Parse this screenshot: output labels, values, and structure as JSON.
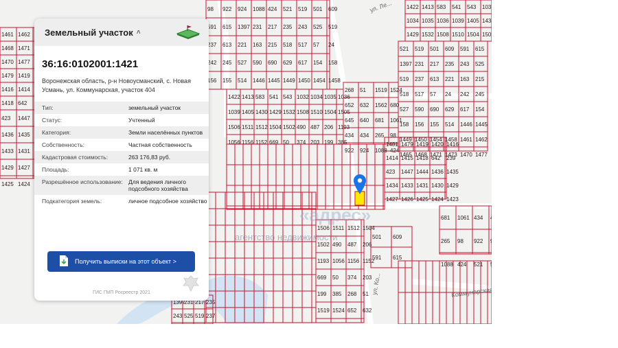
{
  "card": {
    "header_title": "Земельный участок",
    "chevron": "^",
    "cadastral_number": "36:16:0102001:1421",
    "address": "Воронежская область, р-н Новоусманский, с. Новая Усмань, ул. Коммунарская, участок 404",
    "properties": [
      {
        "label": "Тип:",
        "value": "земельный участок"
      },
      {
        "label": "Статус:",
        "value": "Учтенный"
      },
      {
        "label": "Категория:",
        "value": "Земли населённых пунктов"
      },
      {
        "label": "Собственность:",
        "value": "Частная собственность"
      },
      {
        "label": "Кадастровая стоимость:",
        "value": "263 176,83 руб."
      },
      {
        "label": "Площадь:",
        "value": "1 071 кв. м"
      },
      {
        "label": "Разрешённое использование:",
        "value": "Для ведения личного подсобного хозяйства"
      },
      {
        "label": "Подкатегория земель:",
        "value": "личное подсобное хозяйство"
      }
    ],
    "cta_label": "Получить выписки на этот объект >",
    "footer": "ГИС ГМП Росреестр 2021"
  },
  "map": {
    "streets": [
      "ул. Ле...",
      "Коммунарская",
      "ул. Ко..."
    ],
    "watermark_line1": "«адрес»",
    "watermark_line2": "агентство недвижимости",
    "parcel_color": "#c8102e",
    "highlight_color": "#ffe800",
    "marker_color": "#1a73e8",
    "parcel_numbers": [
      "98",
      "922",
      "924",
      "1088",
      "424",
      "521",
      "519",
      "501",
      "609",
      "591",
      "615",
      "1397",
      "231",
      "217",
      "235",
      "243",
      "525",
      "519",
      "237",
      "613",
      "221",
      "163",
      "215",
      "518",
      "517",
      "57",
      "24",
      "242",
      "245",
      "527",
      "590",
      "690",
      "629",
      "617",
      "154",
      "158",
      "156",
      "155",
      "514",
      "1446",
      "1445",
      "1449",
      "1450",
      "1454",
      "1458",
      "1461",
      "1462",
      "1465",
      "1468",
      "1471",
      "1473",
      "1470",
      "1477",
      "1481",
      "1479",
      "1419",
      "1420",
      "1416",
      "1414",
      "1415",
      "1418",
      "642",
      "239",
      "423",
      "1447",
      "1444",
      "1436",
      "1435",
      "1434",
      "1433",
      "1431",
      "1430",
      "1429",
      "1427",
      "1426",
      "1425",
      "1424",
      "1423",
      "1422",
      "1413",
      "583",
      "541",
      "543",
      "1032",
      "1034",
      "1035",
      "1036",
      "1039",
      "1405",
      "1430",
      "1429",
      "1532",
      "1508",
      "1510",
      "1504",
      "1505",
      "1506",
      "1511",
      "1512",
      "1504",
      "1502",
      "490",
      "487",
      "206",
      "1193",
      "1056",
      "1156",
      "1152",
      "669",
      "50",
      "374",
      "203",
      "199",
      "385",
      "268",
      "51",
      "1519",
      "1524",
      "652",
      "632",
      "1562",
      "680",
      "645",
      "640",
      "681",
      "1061",
      "434",
      "434",
      "265"
    ]
  }
}
